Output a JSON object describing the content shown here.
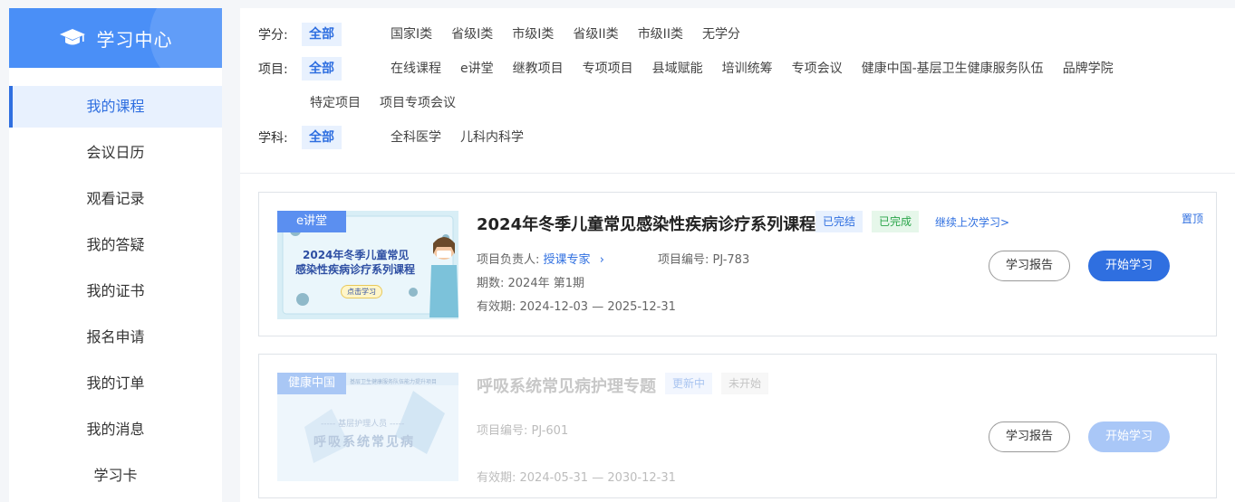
{
  "sidebar": {
    "title": "学习中心",
    "items": [
      {
        "label": "我的课程",
        "active": true
      },
      {
        "label": "会议日历"
      },
      {
        "label": "观看记录"
      },
      {
        "label": "我的答疑"
      },
      {
        "label": "我的证书"
      },
      {
        "label": "报名申请"
      },
      {
        "label": "我的订单"
      },
      {
        "label": "我的消息"
      },
      {
        "label": "学习卡"
      }
    ]
  },
  "filters": {
    "credit": {
      "label": "学分:",
      "all": "全部",
      "options": [
        "国家I类",
        "省级I类",
        "市级I类",
        "省级II类",
        "市级II类",
        "无学分"
      ]
    },
    "project": {
      "label": "项目:",
      "all": "全部",
      "options": [
        "在线课程",
        "e讲堂",
        "继教项目",
        "专项项目",
        "县域赋能",
        "培训统筹",
        "专项会议",
        "健康中国-基层卫生健康服务队伍",
        "品牌学院"
      ],
      "options2": [
        "特定项目",
        "项目专项会议"
      ]
    },
    "subject": {
      "label": "学科:",
      "all": "全部",
      "options": [
        "全科医学",
        "儿科内科学"
      ]
    }
  },
  "courses": [
    {
      "tag": "e讲堂",
      "thumb_line1": "2024年冬季儿童常见",
      "thumb_line2": "感染性疾病诊疗系列课程",
      "thumb_btn": "点击学习",
      "title": "2024年冬季儿童常见感染性疾病诊疗系列课程",
      "status1": "已完结",
      "status2": "已完成",
      "continue": "继续上次学习>",
      "pin": "置顶",
      "leader_label": "项目负责人:",
      "leader": "授课专家",
      "code": "项目编号: PJ-783",
      "period": "期数: 2024年 第1期",
      "validity": "有效期: 2024-12-03 — 2025-12-31",
      "report": "学习报告",
      "start": "开始学习"
    },
    {
      "tag": "健康中国",
      "thumb_top": "基层卫生健康服务队伍能力提升项目",
      "thumb_sub": "----- 基层护理人员 -----",
      "thumb_line1": "呼吸系统常见病",
      "title": "呼吸系统常见病护理专题",
      "status1": "更新中",
      "status2": "未开始",
      "code": "项目编号: PJ-601",
      "validity": "有效期: 2024-05-31 — 2030-12-31",
      "report": "学习报告",
      "start": "开始学习"
    }
  ]
}
